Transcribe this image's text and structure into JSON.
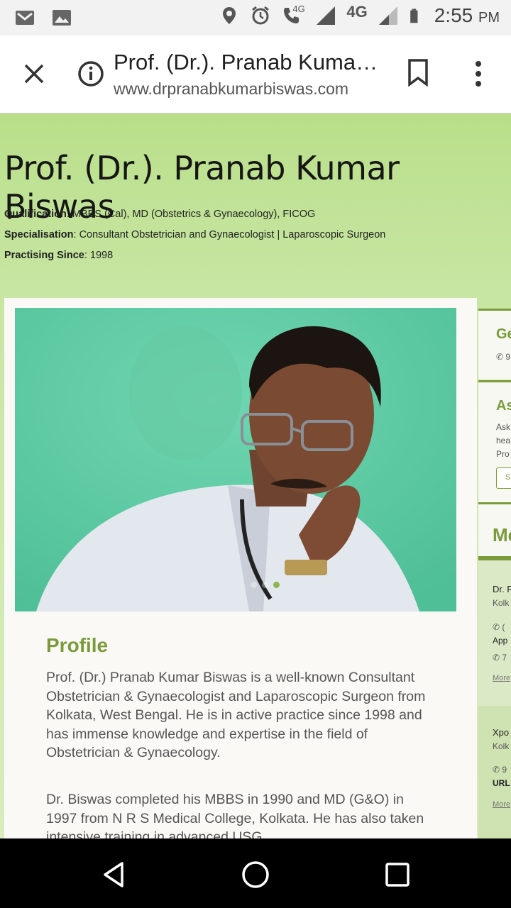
{
  "status_bar": {
    "time": "2:55",
    "ampm": "PM",
    "network_small": "4G",
    "network": "4G",
    "icons": [
      "gmail-icon",
      "gallery-icon",
      "location-icon",
      "alarm-icon",
      "volte-call-icon",
      "signal-icon",
      "signal-icon-2",
      "battery-icon"
    ]
  },
  "browser": {
    "title": "Prof. (Dr.). Pranab Kuma…",
    "url": "www.drpranabkumarbiswas.com"
  },
  "page": {
    "doctor_name": "Prof. (Dr.). Pranab Kumar Biswas",
    "qualification_label": "Qualification",
    "qualification": ": MBBS (Cal), MD (Obstetrics & Gynaecology), FICOG",
    "specialisation_label": "Specialisation",
    "specialisation": ": Consultant Obstetrician and Gynaecologist | Laparoscopic Surgeon",
    "practising_label": "Practising Since",
    "practising": ": 1998",
    "profile_heading": "Profile",
    "profile_p1": "Prof. (Dr.) Pranab Kumar Biswas is a well-known Consultant Obstetrician & Gynaecologist and Laparoscopic Surgeon from Kolkata, West Bengal. He is in active practice since 1998 and has immense knowledge and expertise in the field of Obstetrician & Gynaecology.",
    "profile_p2": "Dr. Biswas completed his MBBS in 1990 and MD (G&O) in 1997 from N R S Medical College, Kolkata.  He has also taken intensive training in advanced USG"
  },
  "sidebar": {
    "sec1_title": "Ge",
    "sec1_phone": "9",
    "sec2_title": "As",
    "sec2_l1": "Ask",
    "sec2_l2": "hea",
    "sec2_l3": "Pro",
    "sec2_btn": "S",
    "sec3_title": "Me",
    "c1_name": "Dr. F",
    "c1_city": "Kolk",
    "c1_l1": "(",
    "c1_l2": "App",
    "c1_l3": "7",
    "c1_more": "More",
    "c2_name": "Xpo",
    "c2_city": "Kolk",
    "c2_l1": "9",
    "c2_l2": "URL",
    "c2_more": "More"
  },
  "colors": {
    "accent": "#7a9b3c",
    "header_bg": "#b9df8a",
    "photo_bg": "#5ec8a2"
  }
}
